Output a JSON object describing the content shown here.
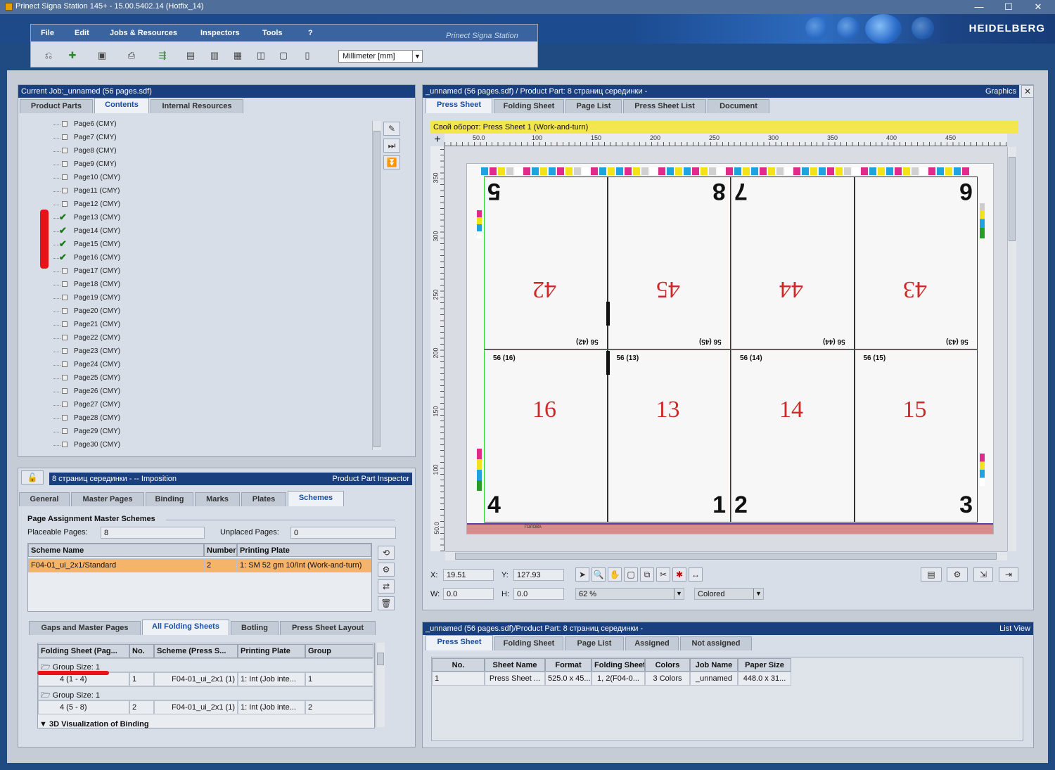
{
  "window": {
    "title": "Prinect Signa Station 145+  -  15.00.5402.14 (Hotfix_14)",
    "minimize": "—",
    "maximize": "☐",
    "close": "✕"
  },
  "brand": "HEIDELBERG",
  "menu": {
    "file": "File",
    "edit": "Edit",
    "jobs": "Jobs & Resources",
    "inspectors": "Inspectors",
    "tools": "Tools",
    "help": "?",
    "product": "Prinect Signa Station"
  },
  "toolbar": {
    "unit": "Millimeter  [mm]"
  },
  "job_panel": {
    "header": "Current Job:_unnamed (56 pages.sdf)",
    "tabs": [
      "Product Parts",
      "Contents",
      "Internal Resources"
    ],
    "pages": [
      {
        "label": "Page6 (CMY)",
        "checked": false
      },
      {
        "label": "Page7 (CMY)",
        "checked": false
      },
      {
        "label": "Page8 (CMY)",
        "checked": false
      },
      {
        "label": "Page9 (CMY)",
        "checked": false
      },
      {
        "label": "Page10 (CMY)",
        "checked": false
      },
      {
        "label": "Page11 (CMY)",
        "checked": false
      },
      {
        "label": "Page12 (CMY)",
        "checked": false
      },
      {
        "label": "Page13 (CMY)",
        "checked": true
      },
      {
        "label": "Page14 (CMY)",
        "checked": true
      },
      {
        "label": "Page15 (CMY)",
        "checked": true
      },
      {
        "label": "Page16 (CMY)",
        "checked": true
      },
      {
        "label": "Page17 (CMY)",
        "checked": false
      },
      {
        "label": "Page18 (CMY)",
        "checked": false
      },
      {
        "label": "Page19 (CMY)",
        "checked": false
      },
      {
        "label": "Page20 (CMY)",
        "checked": false
      },
      {
        "label": "Page21 (CMY)",
        "checked": false
      },
      {
        "label": "Page22 (CMY)",
        "checked": false
      },
      {
        "label": "Page23 (CMY)",
        "checked": false
      },
      {
        "label": "Page24 (CMY)",
        "checked": false
      },
      {
        "label": "Page25 (CMY)",
        "checked": false
      },
      {
        "label": "Page26 (CMY)",
        "checked": false
      },
      {
        "label": "Page27 (CMY)",
        "checked": false
      },
      {
        "label": "Page28 (CMY)",
        "checked": false
      },
      {
        "label": "Page29 (CMY)",
        "checked": false
      },
      {
        "label": "Page30 (CMY)",
        "checked": false
      }
    ]
  },
  "inspector": {
    "header": "8 страниц серединки - -- Imposition",
    "header_right": "Product Part Inspector",
    "tabs": [
      "General",
      "Master Pages",
      "Binding",
      "Marks",
      "Plates",
      "Schemes"
    ],
    "section_title": "Page Assignment  Master Schemes",
    "placeable_label": "Placeable Pages:",
    "placeable_value": "8",
    "unplaced_label": "Unplaced Pages:",
    "unplaced_value": "0",
    "scheme_cols": [
      "Scheme Name",
      "Number",
      "Printing Plate"
    ],
    "scheme_row": [
      "F04-01_ui_2x1/Standard",
      "2",
      "1: SM 52 gm 10/Int (Work-and-turn)"
    ],
    "subtabs": [
      "Gaps and Master Pages",
      "All Folding Sheets",
      "Botling",
      "Press Sheet Layout"
    ],
    "fs_cols": [
      "Folding Sheet (Pag...",
      "No.",
      "Scheme (Press S...",
      "Printing Plate",
      "Group"
    ],
    "fs_groups": [
      {
        "group": "Group Size: 1",
        "row": [
          "4 (1 - 4)",
          "1",
          "F04-01_ui_2x1  (1)",
          "1: Int (Job inte...",
          "1"
        ]
      },
      {
        "group": "Group Size: 1",
        "row": [
          "4 (5 - 8)",
          "2",
          "F04-01_ui_2x1  (1)",
          "1: Int (Job inte...",
          "2"
        ]
      }
    ],
    "visual_label": "3D Visualization of Binding"
  },
  "graphics": {
    "header": "_unnamed (56 pages.sdf) / Product Part: 8 страниц серединки -",
    "header_right": "Graphics",
    "tabs": [
      "Press Sheet",
      "Folding Sheet",
      "Page List",
      "Press Sheet List",
      "Document"
    ],
    "sheet_title": "Свой оборот:  Press Sheet 1 (Work-and-turn)",
    "hruler": [
      "50.0",
      "100",
      "150",
      "200",
      "250",
      "300",
      "350",
      "400",
      "450"
    ],
    "vruler": [
      "350",
      "300",
      "250",
      "200",
      "150",
      "100",
      "50.0"
    ],
    "top_row": [
      {
        "num": "5",
        "folio": "42",
        "mini": "56 (42)"
      },
      {
        "num": "8",
        "folio": "45",
        "mini": "56 (45)"
      },
      {
        "num": "7",
        "folio": "44",
        "mini": "56 (44)"
      },
      {
        "num": "6",
        "folio": "43",
        "mini": "56 (43)"
      }
    ],
    "bottom_row": [
      {
        "num": "4",
        "folio": "16",
        "mini": "56 (16)"
      },
      {
        "num": "1",
        "folio": "13",
        "mini": "56 (13)"
      },
      {
        "num": "2",
        "folio": "14",
        "mini": "56 (14)"
      },
      {
        "num": "3",
        "folio": "15",
        "mini": "56 (15)"
      }
    ],
    "footer_label": "ГОЛОВА",
    "x_label": "X:",
    "x_value": "19.51",
    "y_label": "Y:",
    "y_value": "127.93",
    "w_label": "W:",
    "w_value": "0.0",
    "h_label": "H:",
    "h_value": "0.0",
    "zoom": "62 %",
    "color_mode": "Colored"
  },
  "list_view": {
    "header": "_unnamed (56 pages.sdf)/Product Part: 8 страниц серединки -",
    "header_right": "List View",
    "tabs": [
      "Press Sheet",
      "Folding Sheet",
      "Page List",
      "Assigned",
      "Not assigned"
    ],
    "cols": [
      "No.",
      "Sheet Name",
      "Format",
      "Folding Sheet",
      "Colors",
      "Job Name",
      "Paper Size"
    ],
    "row": [
      "1",
      "Press Sheet ...",
      "525.0 x 45...",
      "1, 2(F04-0...",
      "3 Colors",
      "_unnamed",
      "448.0 x 31..."
    ]
  }
}
